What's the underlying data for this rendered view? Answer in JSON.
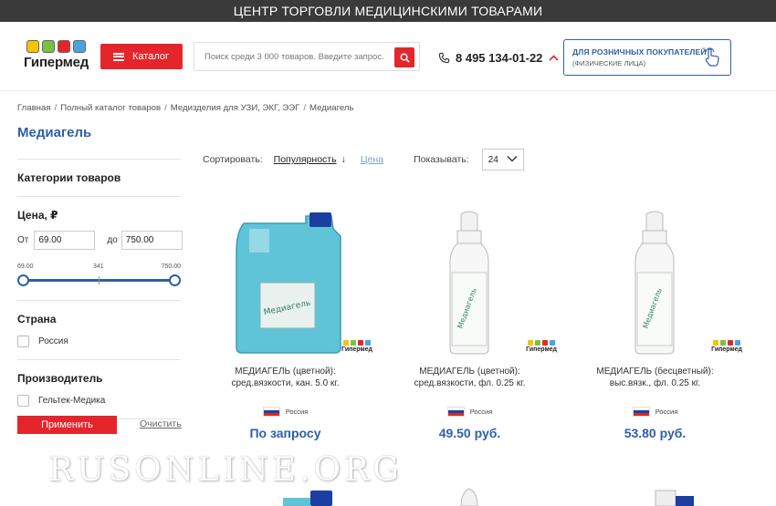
{
  "topbar": {
    "text": "ЦЕНТР ТОРГОВЛИ МЕДИЦИНСКИМИ ТОВАРАМИ"
  },
  "header": {
    "logo_text": "Гипермед",
    "catalog_label": "Каталог",
    "search_placeholder": "Поиск среди 3 000 товаров. Введите запрос.",
    "phone": "8 495 134-01-22",
    "retail_title": "ДЛЯ РОЗНИЧНЫХ ПОКУПАТЕЛЕЙ",
    "retail_sub": "(ФИЗИЧЕСКИЕ ЛИЦА)"
  },
  "breadcrumb": [
    "Главная",
    "Полный каталог товаров",
    "Медизделия для УЗИ, ЭКГ, ЭЭГ",
    "Медиагель"
  ],
  "page_title": "Медиагель",
  "filters": {
    "categories_title": "Категории товаров",
    "price_title": "Цена, ₽",
    "from_label": "От",
    "to_label": "до",
    "price_from": "69.00",
    "price_to": "750.00",
    "slider_min": "69.00",
    "slider_mid": "341",
    "slider_max": "750.00",
    "country_title": "Страна",
    "country_option": "Россия",
    "maker_title": "Производитель",
    "maker_option": "Гельтек-Медика",
    "apply_label": "Применить",
    "clear_label": "Очистить"
  },
  "sort": {
    "label": "Сортировать:",
    "popularity": "Популярность",
    "arrow": "↓",
    "price": "Цена",
    "show_label": "Показывать:",
    "per_page": "24"
  },
  "products": [
    {
      "name_line1": "МЕДИАГЕЛЬ (цветной):",
      "name_line2": "сред.вязкости, кан. 5.0 кг.",
      "country": "Россия",
      "price": "По запросу"
    },
    {
      "name_line1": "МЕДИАГЕЛЬ (цветной):",
      "name_line2": "сред.вязкости, фл. 0.25 кг.",
      "country": "Россия",
      "price": "49.50 руб."
    },
    {
      "name_line1": "МЕДИАГЕЛЬ (бесцветный):",
      "name_line2": "выс.вязк., фл. 0.25 кг.",
      "country": "Россия",
      "price": "53.80 руб."
    }
  ],
  "watermark": "RUSONLINE.ORG",
  "colors": {
    "accent_red": "#e4262c",
    "brand_blue": "#2f5fa8",
    "topbar": "#3a3a3a"
  },
  "icons": [
    "search-icon",
    "phone-icon",
    "chevron-up-icon",
    "hand-pointer-icon",
    "chevron-down-icon",
    "flag-russia-icon"
  ]
}
